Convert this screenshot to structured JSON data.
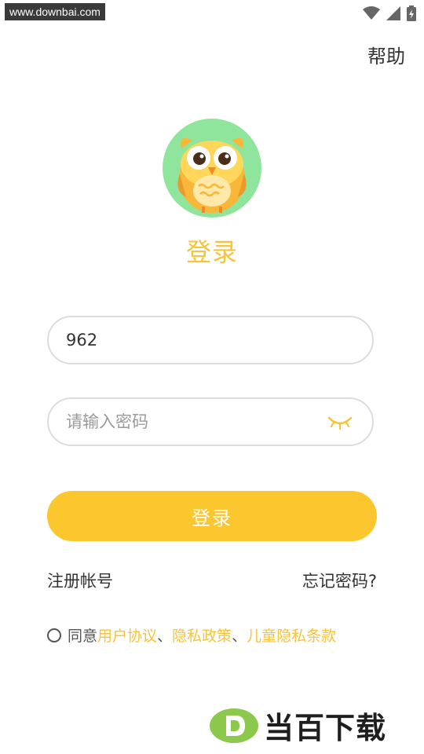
{
  "status": {
    "watermark": "www.downbai.com",
    "wifi_icon": "wifi-icon",
    "signal_icon": "signal-icon",
    "battery_icon": "battery-icon"
  },
  "header": {
    "help": "帮助"
  },
  "logo": {
    "icon": "owl-avatar-icon",
    "bg": "#8FE59B"
  },
  "title": "登录",
  "form": {
    "phone_value": "962",
    "password_placeholder": "请输入密码",
    "eye_icon": "eye-closed-icon",
    "submit": "登录"
  },
  "links": {
    "register": "注册帐号",
    "forgot": "忘记密码?"
  },
  "agreement": {
    "prefix": "同意",
    "user_agreement": "用户协议",
    "sep1": "、",
    "privacy_policy": "隐私政策",
    "sep2": "、",
    "child_privacy": "儿童隐私条款"
  },
  "footer": {
    "brand": "当百下载"
  },
  "colors": {
    "accent": "#FCC62E",
    "accent_text": "#F5C43A",
    "field_border": "#dcdcdc"
  }
}
